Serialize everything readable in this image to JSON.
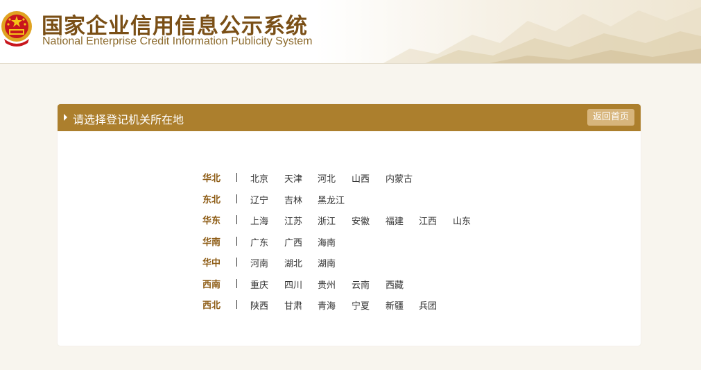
{
  "header": {
    "title_cn": "国家企业信用信息公示系统",
    "title_en": "National Enterprise Credit Information Publicity System",
    "emblem_icon": "national-emblem-icon",
    "brand_color": "#7a4f16"
  },
  "panel": {
    "title": "请选择登记机关所在地",
    "back_label": "返回首页",
    "head_color": "#ac7f2d"
  },
  "regions": [
    {
      "name": "华北",
      "provinces": [
        "北京",
        "天津",
        "河北",
        "山西",
        "内蒙古"
      ]
    },
    {
      "name": "东北",
      "provinces": [
        "辽宁",
        "吉林",
        "黑龙江"
      ]
    },
    {
      "name": "华东",
      "provinces": [
        "上海",
        "江苏",
        "浙江",
        "安徽",
        "福建",
        "江西",
        "山东"
      ]
    },
    {
      "name": "华南",
      "provinces": [
        "广东",
        "广西",
        "海南"
      ]
    },
    {
      "name": "华中",
      "provinces": [
        "河南",
        "湖北",
        "湖南"
      ]
    },
    {
      "name": "西南",
      "provinces": [
        "重庆",
        "四川",
        "贵州",
        "云南",
        "西藏"
      ]
    },
    {
      "name": "西北",
      "provinces": [
        "陕西",
        "甘肃",
        "青海",
        "宁夏",
        "新疆",
        "兵团"
      ]
    }
  ]
}
